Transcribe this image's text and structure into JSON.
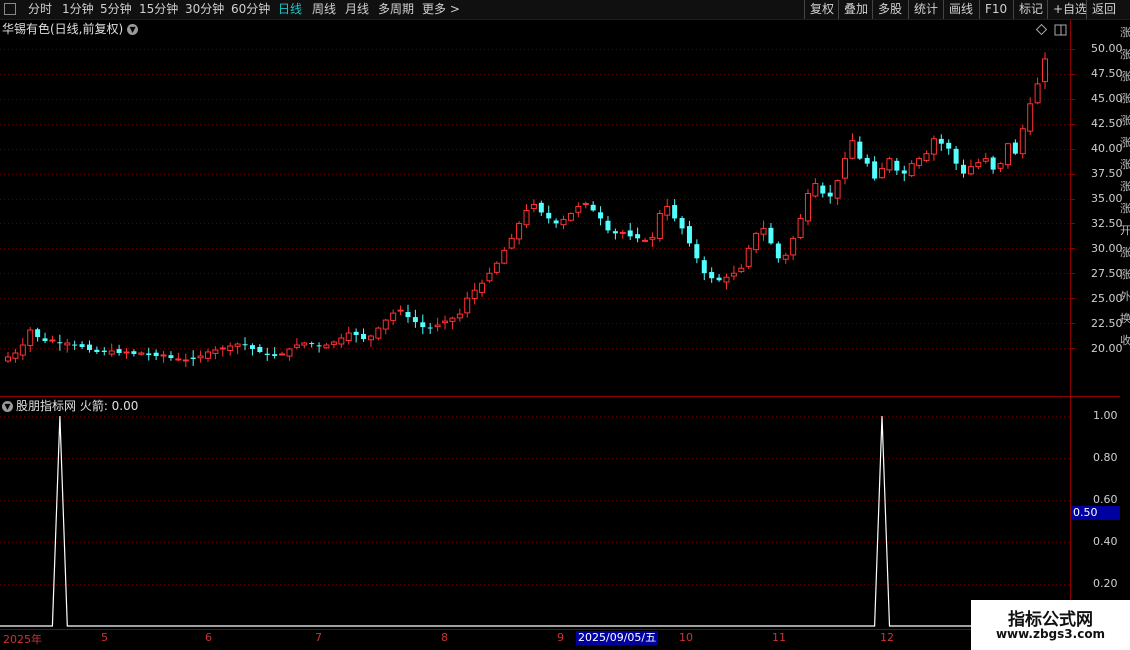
{
  "toolbar": {
    "left_items": [
      "分时",
      "1分钟",
      "5分钟",
      "15分钟",
      "30分钟",
      "60分钟",
      "日线",
      "周线",
      "月线",
      "多周期",
      "更多 >"
    ],
    "active": "日线",
    "right_items": [
      "复权",
      "叠加",
      "多股",
      "统计",
      "画线",
      "F10",
      "标记",
      "+自选",
      "返回"
    ]
  },
  "main_panel": {
    "title": "华锡有色(日线,前复权)",
    "y_axis": [
      "50.00",
      "47.50",
      "45.00",
      "42.50",
      "40.00",
      "37.50",
      "35.00",
      "32.50",
      "30.00",
      "27.50",
      "25.00",
      "22.50",
      "20.00"
    ]
  },
  "indicator_panel": {
    "title": "股朋指标网 火箭: 0.00",
    "y_axis": [
      "1.00",
      "0.80",
      "0.60",
      "0.40",
      "0.20"
    ],
    "cursor_value": "0.50"
  },
  "x_axis": {
    "labels": [
      "2025年",
      "5",
      "6",
      "7",
      "8",
      "9",
      "10",
      "11",
      "12"
    ],
    "cursor_date": "2025/09/05/五"
  },
  "watermark": {
    "line1": "指标公式网",
    "line2": "www.zbgs3.com"
  },
  "right_edge_chars": [
    "涨",
    "涨",
    "涨",
    "涨",
    "涨",
    "涨",
    "涨",
    "涨",
    "涨",
    "开",
    "涨",
    "涨",
    "外",
    "换",
    "收",
    "",
    "",
    "",
    "",
    "",
    "",
    "",
    "",
    "",
    "",
    "",
    ""
  ],
  "colors": {
    "up": "#ff3232",
    "down": "#54ffff",
    "grid": "#5a0000",
    "signal": "#ffffff",
    "cursor_bg": "#0000a0"
  },
  "chart_data": [
    {
      "type": "candlestick",
      "title": "华锡有色(日线,前复权)",
      "ylim": [
        17.5,
        51.0
      ],
      "close": [
        19.1,
        19.5,
        20.3,
        21.8,
        21.1,
        20.7,
        20.8,
        20.5,
        20.5,
        20.3,
        20.1,
        19.8,
        19.6,
        19.6,
        19.7,
        19.5,
        19.6,
        19.4,
        19.5,
        19.3,
        19.2,
        19.3,
        19.0,
        18.9,
        18.8,
        18.9,
        19.2,
        19.6,
        19.8,
        20.0,
        20.2,
        20.4,
        20.3,
        19.9,
        19.6,
        19.3,
        19.2,
        19.4,
        19.9,
        20.3,
        20.5,
        20.4,
        20.2,
        20.3,
        20.6,
        21.0,
        21.5,
        21.3,
        20.9,
        21.2,
        22.0,
        22.8,
        23.5,
        23.8,
        23.1,
        22.6,
        22.1,
        22.0,
        22.3,
        22.7,
        23.0,
        23.4,
        25.0,
        25.8,
        26.5,
        27.5,
        28.5,
        29.8,
        31.0,
        32.5,
        33.8,
        34.4,
        33.6,
        33.0,
        32.5,
        32.9,
        33.5,
        34.2,
        34.5,
        33.8,
        33.0,
        31.8,
        31.5,
        31.6,
        31.2,
        31.0,
        30.8,
        31.1,
        33.5,
        34.2,
        33.0,
        32.0,
        30.5,
        29.0,
        27.5,
        27.0,
        26.8,
        27.1,
        27.5,
        28.0,
        30.0,
        31.5,
        32.0,
        30.5,
        29.0,
        29.3,
        31.0,
        33.0,
        35.5,
        36.5,
        35.5,
        35.2,
        36.8,
        39.0,
        40.8,
        39.0,
        38.5,
        37.0,
        38.0,
        39.0,
        37.8,
        37.5,
        38.5,
        39.0,
        39.5,
        41.0,
        40.5,
        40.0,
        38.5,
        37.5,
        38.2,
        38.6,
        39.0,
        37.9,
        38.5,
        40.5,
        39.5,
        42.0,
        44.5,
        46.5,
        49.0
      ],
      "x_labels": [
        "2025年",
        "5",
        "6",
        "7",
        "8",
        "9",
        "10",
        "11",
        "12"
      ]
    },
    {
      "type": "line",
      "series": [
        {
          "name": "火箭",
          "spikes_at": [
            7,
            118
          ]
        }
      ],
      "ylim": [
        0,
        1.05
      ]
    }
  ]
}
